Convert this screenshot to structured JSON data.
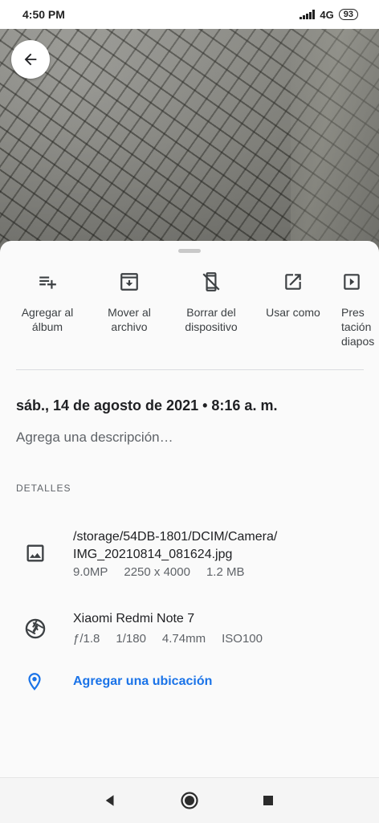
{
  "status": {
    "time": "4:50 PM",
    "network": "4G",
    "battery": "93"
  },
  "photo": {
    "back_icon": "arrow-back-icon"
  },
  "actions": [
    {
      "label": "Agregar al\nálbum",
      "icon": "playlist-add-icon"
    },
    {
      "label": "Mover al\narchivo",
      "icon": "archive-icon"
    },
    {
      "label": "Borrar del\ndispositivo",
      "icon": "phone-delete-icon"
    },
    {
      "label": "Usar como",
      "icon": "open-in-new-icon"
    },
    {
      "label": "Pres\ntación\ndiapos",
      "icon": "slideshow-icon"
    }
  ],
  "info": {
    "date": "sáb., 14 de agosto de 2021 • 8:16 a. m.",
    "description_placeholder": "Agrega una descripción…"
  },
  "details": {
    "title": "DETALLES",
    "file": {
      "path": "/storage/54DB-1801/DCIM/Camera/\nIMG_20210814_081624.jpg",
      "megapixels": "9.0MP",
      "resolution": "2250 x 4000",
      "size": "1.2 MB"
    },
    "camera": {
      "device": "Xiaomi Redmi Note 7",
      "aperture": "ƒ/1.8",
      "shutter": "1/180",
      "focal": "4.74mm",
      "iso": "ISO100"
    },
    "location_label": "Agregar una ubicación"
  },
  "navbar": {
    "back": "nav-back-icon",
    "home": "nav-home-icon",
    "recents": "nav-recents-icon"
  },
  "colors": {
    "accent": "#1a73e8",
    "text": "#202124",
    "secondary": "#5f6368"
  }
}
